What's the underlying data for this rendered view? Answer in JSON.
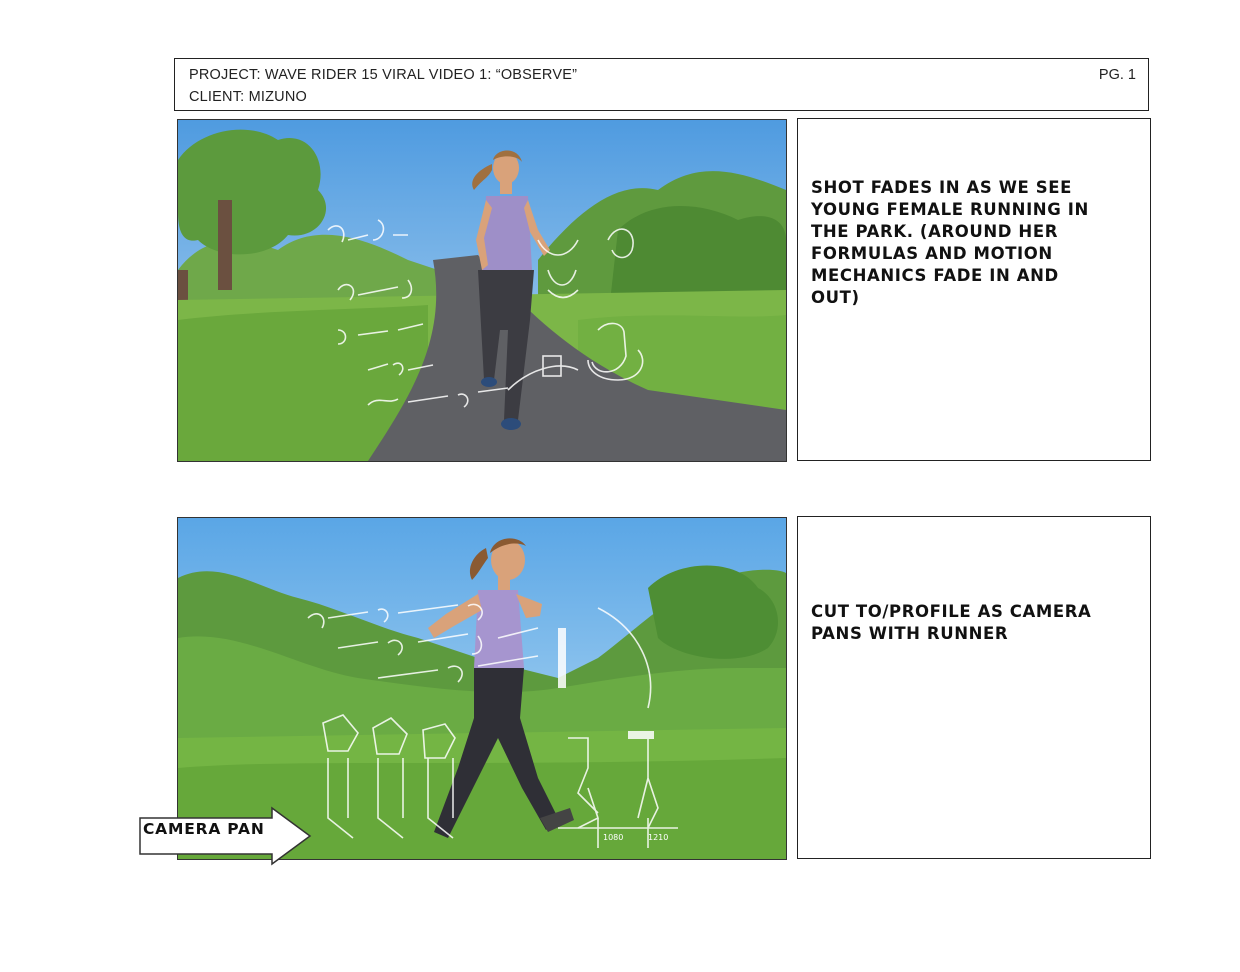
{
  "header": {
    "project_line": "PROJECT: WAVE RIDER 15 VIRAL VIDEO 1: “OBSERVE”",
    "client_line": "CLIENT: MIZUNO",
    "page_label": "PG. 1"
  },
  "panels": [
    {
      "description": "SHOT FADES IN AS WE SEE\nYOUNG FEMALE RUNNING IN\nTHE PARK. (AROUND HER\nFORMULAS AND MOTION\nMECHANICS FADE IN AND\nOUT)"
    },
    {
      "description": "CUT TO/PROFILE AS CAMERA\nPANS WITH RUNNER",
      "camera_direction": "CAMERA PAN",
      "overlay_labels": [
        "1080",
        "1210"
      ]
    }
  ]
}
